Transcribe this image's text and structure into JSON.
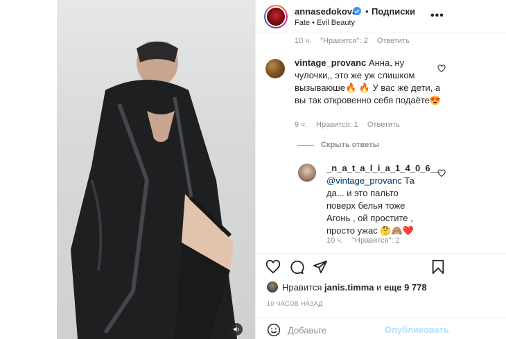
{
  "header": {
    "username": "annasedokova",
    "dot": "•",
    "follow_state": "Подписки",
    "location": "Fate • Evil Beauty",
    "more": "•••"
  },
  "comments": {
    "top_meta": {
      "time": "10 ч.",
      "likes": "\"Нравится\": 2",
      "reply": "Ответить"
    },
    "comment1": {
      "username": "vintage_provanc",
      "text": "Анна, ну чулочки,, это же уж слишком вызываюше🔥 🔥 У вас же дети, а вы так откровенно себя подаёте😍",
      "time": "9 ч.",
      "likes": "Нравится: 1",
      "reply": "Ответить"
    },
    "toggle_replies": "Скрыть ответы",
    "reply1": {
      "username": "_n_a_t_a_l_i_a_1_4_0_6__",
      "mention": "@vintage_provanc",
      "text": "Та да... и это пальто поверх белья тоже Агонь , ой простите , просто ужас 🤔🙈❤️",
      "time": "10 ч.",
      "likes": "\"Нравится\": 2"
    }
  },
  "likes": {
    "prefix": "Нравится",
    "user": "janis.timma",
    "conj": "и",
    "count": "еще 9 778"
  },
  "timestamp": "10 ЧАСОВ НАЗАД",
  "add_comment": {
    "placeholder": "Добавьте",
    "publish": "Опубликовать"
  },
  "icons": {
    "heart": "heart-icon",
    "comment": "comment-icon",
    "share": "paper-plane-icon",
    "save": "bookmark-icon",
    "emoji": "smiley-icon",
    "volume": "speaker-icon",
    "verified": "verified-badge-icon"
  },
  "colors": {
    "verified": "#3897f0",
    "link": "#00376b",
    "publish_disabled": "#b2dffc",
    "meta": "#8e8e8e"
  }
}
